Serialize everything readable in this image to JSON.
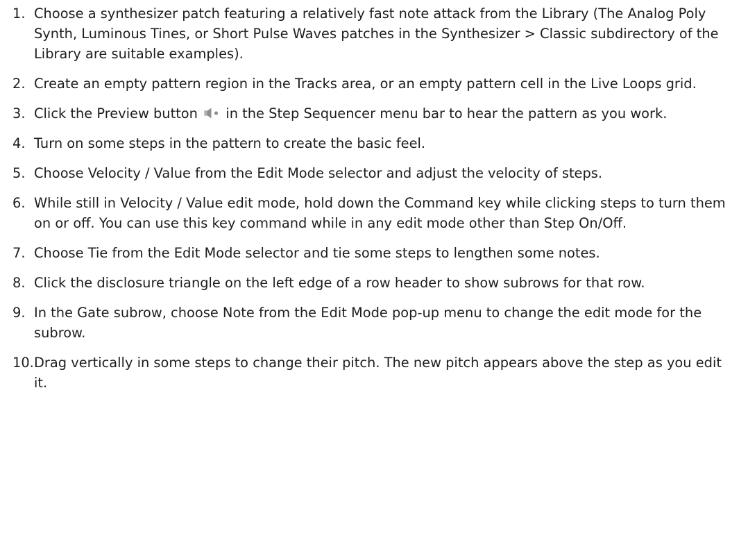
{
  "steps": [
    {
      "number": "1.",
      "text": "Choose a synthesizer patch featuring a relatively fast note attack from the Library (The Analog Poly Synth, Luminous Tines, or Short Pulse Waves patches in the Synthesizer > Classic subdirectory of the Library are suitable examples)."
    },
    {
      "number": "2.",
      "text": "Create an empty pattern region in the Tracks area, or an empty pattern cell in the Live Loops grid."
    },
    {
      "number": "3.",
      "text_before": "Click the Preview button",
      "icon": "preview-speaker-icon",
      "text_after": "in the Step Sequencer menu bar to hear the pattern as you work."
    },
    {
      "number": "4.",
      "text": "Turn on some steps in the pattern to create the basic feel."
    },
    {
      "number": "5.",
      "text": "Choose Velocity / Value from the Edit Mode selector and adjust the velocity of steps."
    },
    {
      "number": "6.",
      "text": "While still in Velocity / Value edit mode, hold down the Command key while clicking steps to turn them on or off. You can use this key command while in any edit mode other than Step On/Off."
    },
    {
      "number": "7.",
      "text": "Choose Tie from the Edit Mode selector and tie some steps to lengthen some notes."
    },
    {
      "number": "8.",
      "text": "Click the disclosure triangle on the left edge of a row header to show subrows for that row."
    },
    {
      "number": "9.",
      "text": "In the Gate subrow, choose Note from the Edit Mode pop-up menu to change the edit mode for the subrow."
    },
    {
      "number": "10.",
      "text": "Drag vertically in some steps to change their pitch. The new pitch appears above the step as you edit it."
    }
  ],
  "colors": {
    "text": "#1d1d1f",
    "icon": "#8e8e93",
    "background": "#ffffff"
  }
}
